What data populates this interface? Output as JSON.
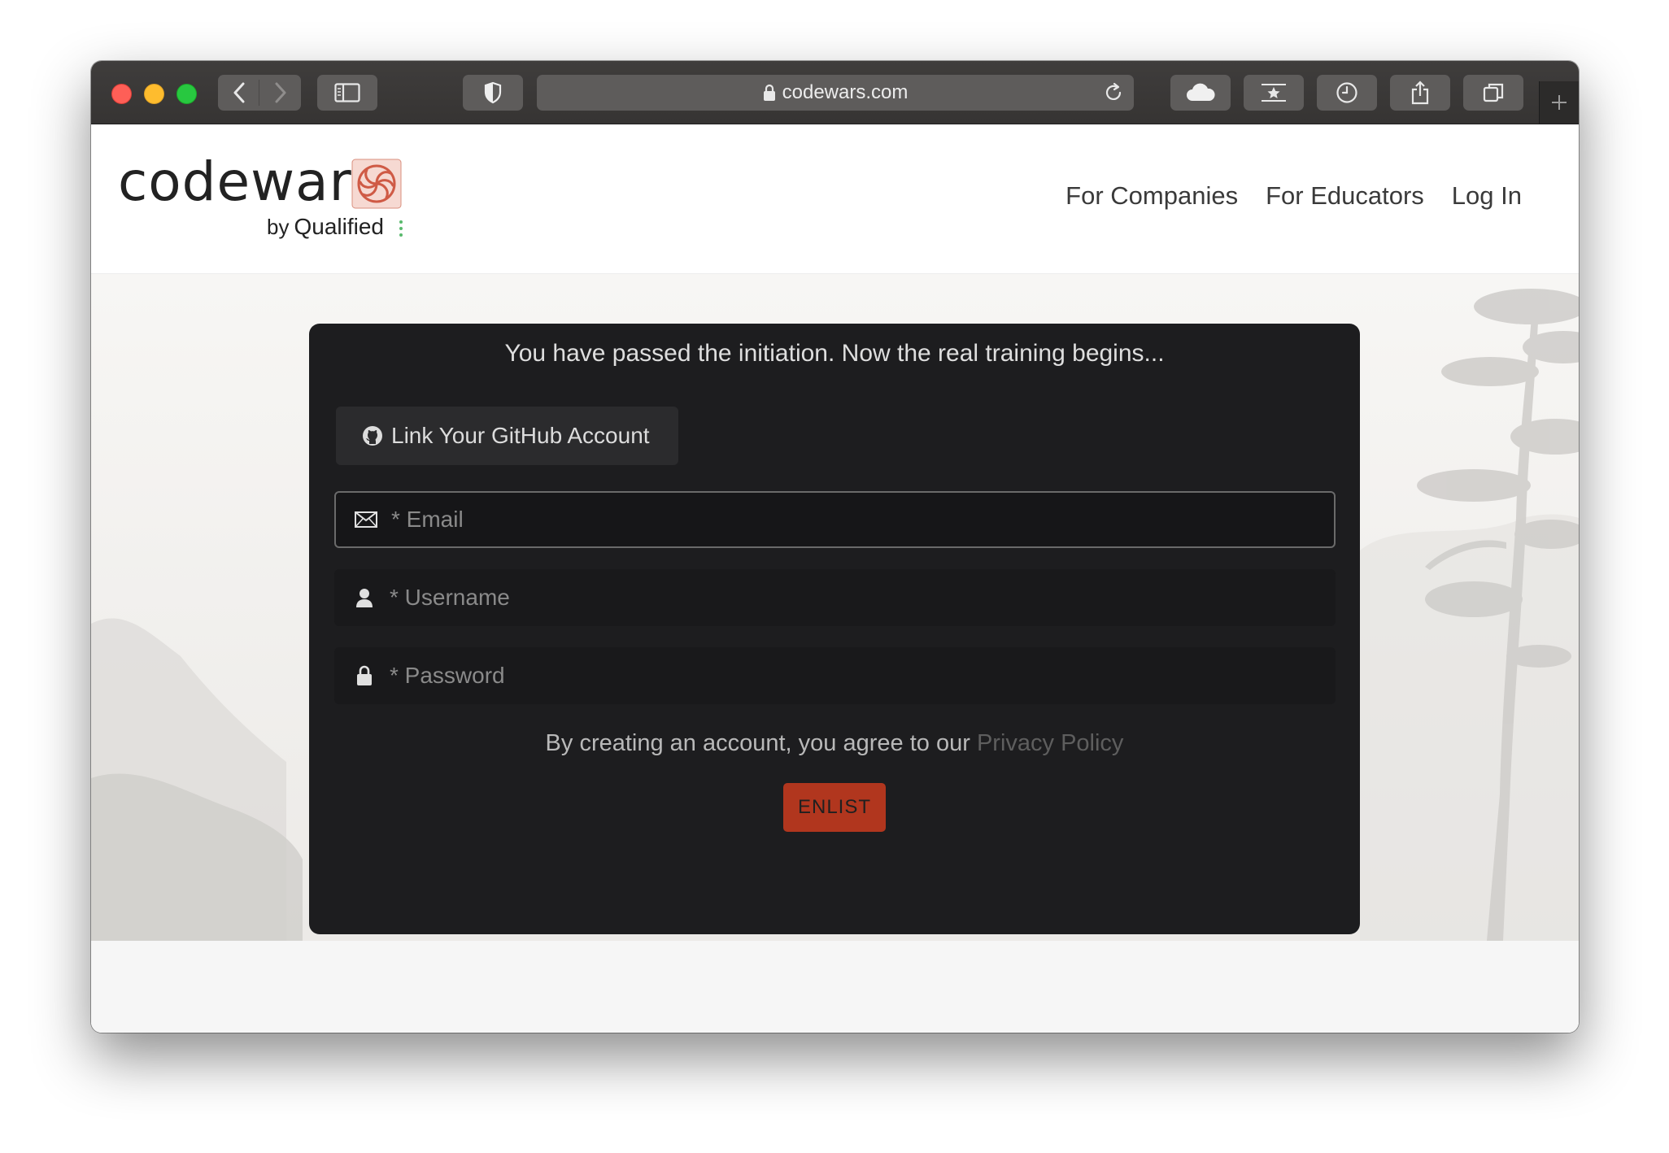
{
  "browser": {
    "url": "codewars.com"
  },
  "header": {
    "logo_text": "codewars",
    "logo_by": "by",
    "logo_company": "Qualified",
    "nav": [
      {
        "label": "For Companies"
      },
      {
        "label": "For Educators"
      },
      {
        "label": "Log In"
      }
    ]
  },
  "signup": {
    "title": "You have passed the initiation. Now the real training begins...",
    "github_button": "Link Your GitHub Account",
    "email_placeholder": "* Email",
    "username_placeholder": "* Username",
    "password_placeholder": "* Password",
    "agree_text": "By creating an account, you agree to our",
    "privacy_link": "Privacy Policy",
    "submit_label": "ENLIST"
  },
  "colors": {
    "brand_red": "#b1361e",
    "card_bg": "#1d1d1f"
  }
}
